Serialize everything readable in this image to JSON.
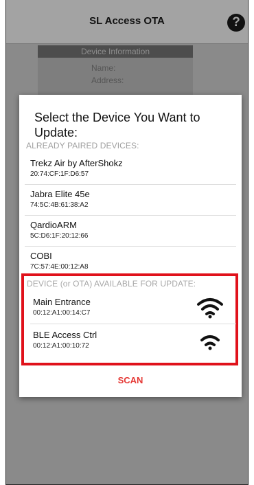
{
  "app": {
    "title": "SL Access OTA",
    "help_icon_glyph": "?"
  },
  "info_card": {
    "header": "Device Information",
    "name_label": "Name:",
    "address_label": "Address:"
  },
  "dialog": {
    "title": "Select the Device You Want to Update:",
    "paired_header": "ALREADY PAIRED DEVICES:",
    "paired_devices": [
      {
        "name": "Trekz Air by AfterShokz",
        "address": "20:74:CF:1F:D6:57"
      },
      {
        "name": "Jabra Elite 45e",
        "address": "74:5C:4B:61:38:A2"
      },
      {
        "name": "QardioARM",
        "address": "5C:D6:1F:20:12:66"
      },
      {
        "name": "COBI",
        "address": "7C:57:4E:00:12:A8"
      }
    ],
    "ota_header": "DEVICE (or OTA) AVAILABLE FOR UPDATE:",
    "ota_devices": [
      {
        "name": "Main Entrance",
        "address": "00:12:A1:00:14:C7",
        "signal_icon": "wifi-strong-icon",
        "signal_bars": 3
      },
      {
        "name": "BLE Access Ctrl",
        "address": "00:12:A1:00:10:72",
        "signal_icon": "wifi-medium-icon",
        "signal_bars": 2
      }
    ],
    "scan_label": "SCAN"
  },
  "colors": {
    "highlight": "#e0121b",
    "scan": "#e53935",
    "appbar": "#a3a3a3"
  }
}
